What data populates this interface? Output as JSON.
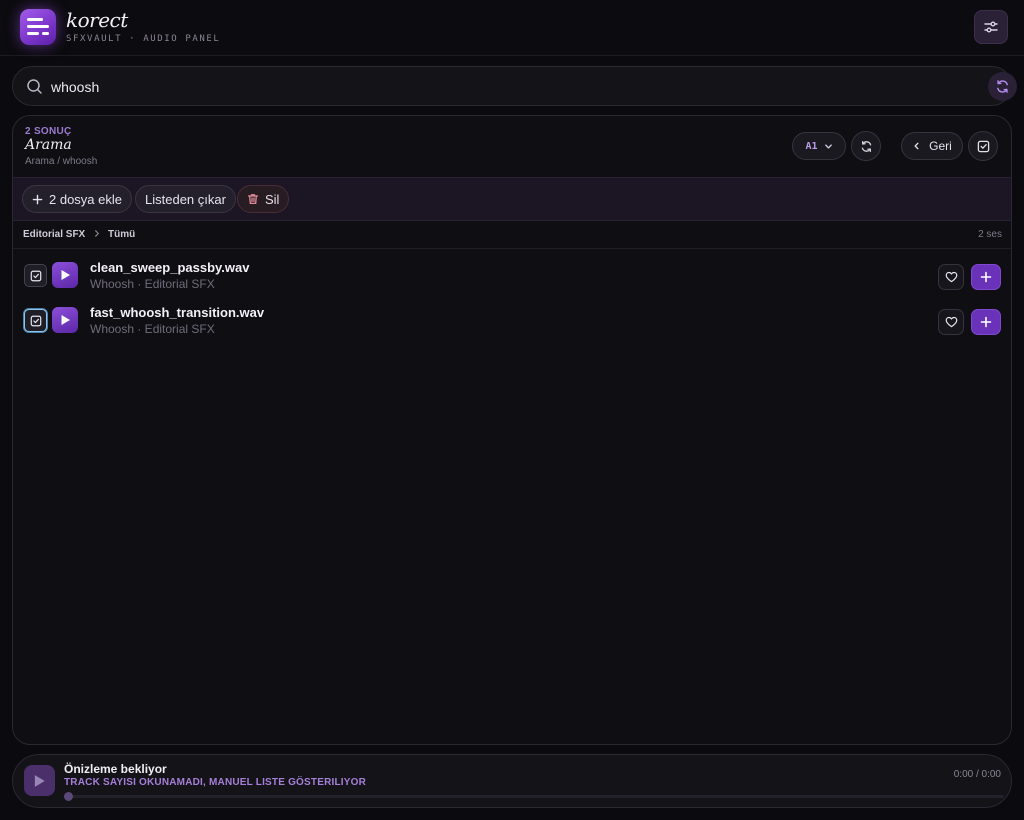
{
  "app": {
    "name": "korect",
    "subtitle": "SFXVAULT · AUDIO PANEL"
  },
  "search": {
    "value": "whoosh",
    "placeholder": ""
  },
  "panel": {
    "result_count": "2 SONUÇ",
    "title": "Arama",
    "path": "Arama / whoosh",
    "version_select": "A1",
    "back_label": "Geri"
  },
  "toolbar": {
    "add_files": "2 dosya ekle",
    "remove_from_list": "Listeden çıkar",
    "delete": "Sil"
  },
  "breadcrumb": {
    "library": "Editorial SFX",
    "filter": "Tümü",
    "count": "2 ses"
  },
  "tracks": [
    {
      "title": "clean_sweep_passby.wav",
      "subtitle": "Whoosh · Editorial SFX",
      "checked": true
    },
    {
      "title": "fast_whoosh_transition.wav",
      "subtitle": "Whoosh · Editorial SFX",
      "checked": true
    }
  ],
  "player": {
    "title": "Önizleme bekliyor",
    "status": "TRACK SAYISI OKUNAMADI, MANUEL LISTE GÖSTERILIYOR",
    "time": "0:00 / 0:00",
    "progress": 0
  },
  "colors": {
    "accent": "#7a34c9",
    "background": "#0b0a0e",
    "panel": "#0f0e13"
  },
  "icons": {
    "logo": "equalizer-lines-icon",
    "settings": "sliders-icon",
    "search": "search-icon",
    "refresh": "refresh-icon",
    "back": "chevron-left-icon",
    "select_all": "checkbox-icon",
    "add": "plus-icon",
    "delete": "trash-icon",
    "play": "play-icon",
    "favorite": "heart-icon"
  }
}
